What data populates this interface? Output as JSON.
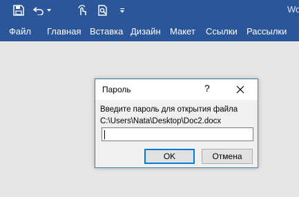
{
  "app": {
    "title": "Wo"
  },
  "quick_access": [
    {
      "name": "save-icon"
    },
    {
      "name": "undo-icon"
    },
    {
      "name": "undo-dropdown-icon"
    },
    {
      "name": "touch-mode-icon"
    },
    {
      "name": "print-preview-icon"
    },
    {
      "name": "customize-toolbar-icon"
    }
  ],
  "ribbon": {
    "tabs": [
      "Файл",
      "Главная",
      "Вставка",
      "Дизайн",
      "Макет",
      "Ссылки",
      "Рассылки"
    ]
  },
  "dialog": {
    "title": "Пароль",
    "help": "?",
    "prompt": "Введите пароль для открытия файла",
    "file_path": "C:\\Users\\Nata\\Desktop\\Doc2.docx",
    "password_value": "",
    "ok_label": "OK",
    "cancel_label": "Отмена"
  },
  "colors": {
    "ribbon": "#2b579a",
    "dialog_border": "#3c7fb1",
    "default_button_border": "#0078d7",
    "workspace": "#e6e6e6"
  }
}
